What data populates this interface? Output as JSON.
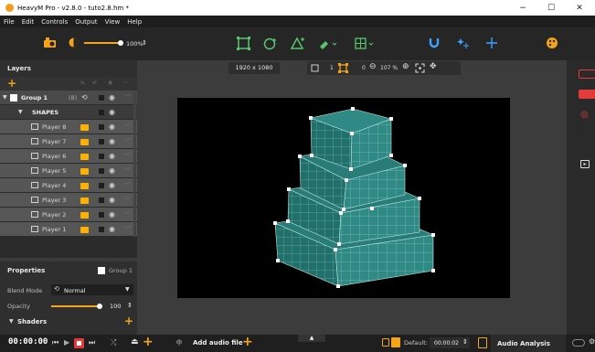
{
  "window": {
    "title": "HeavyM Pro - v2.8.0 - tuto2.8.hm *",
    "minimize": "−",
    "maximize": "☐",
    "close": "✕"
  },
  "menu": [
    "File",
    "Edit",
    "Controls",
    "Output",
    "View",
    "Help"
  ],
  "toolbar": {
    "brightness_value": "100%",
    "stepper": "⇕"
  },
  "layers": {
    "title": "Layers",
    "group": {
      "label": "Group 1",
      "count": "(8)"
    },
    "shapes_label": "SHAPES",
    "players": [
      "Player 8",
      "Player 7",
      "Player 6",
      "Player 5",
      "Player 4",
      "Player 3",
      "Player 2",
      "Player 1"
    ]
  },
  "stage": {
    "resolution": "1920 x 1080",
    "zoom_value": "107 %",
    "counter_a": "1",
    "counter_b": "0"
  },
  "properties": {
    "title": "Properties",
    "target": "Group 1",
    "blend_label": "Blend Mode",
    "blend_value": "Normal",
    "opacity_label": "Opacity",
    "opacity_value": "100",
    "opacity_level": 1.0,
    "shaders_label": "Shaders"
  },
  "bottom": {
    "timecode": "00:00:00",
    "add_audio": "Add audio file",
    "default_label": "Default:",
    "default_time": "00:00:02",
    "audio_analysis": "Audio Analysis"
  },
  "colors": {
    "accent_orange": "#f5a41a",
    "accent_green": "#55c56e",
    "accent_blue": "#3fa2ff",
    "record_red": "#e33a3a",
    "shape_teal": "#2f8a86",
    "selected_row": "#565656"
  }
}
